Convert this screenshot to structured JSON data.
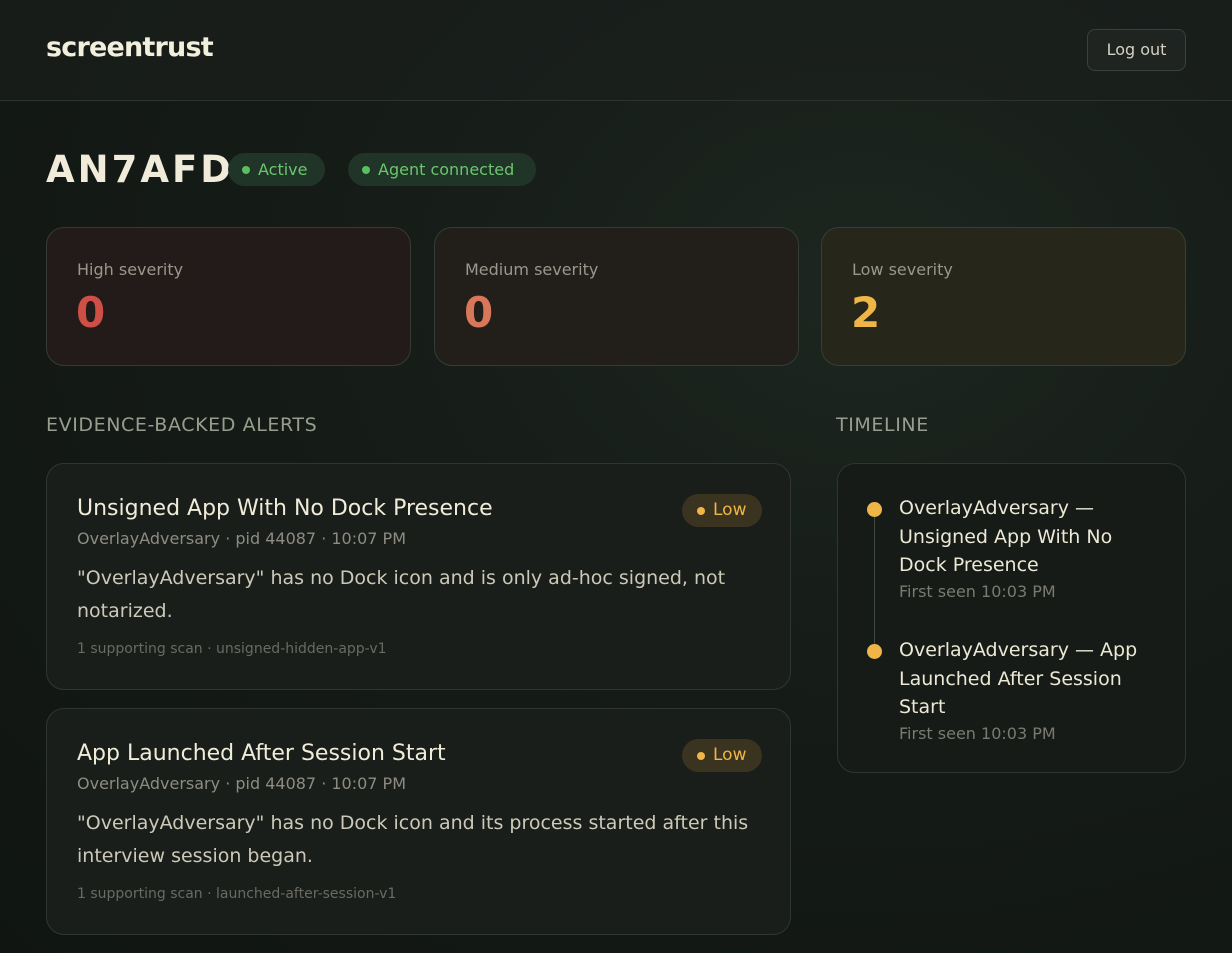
{
  "header": {
    "brand": "screentrust",
    "logout_label": "Log out"
  },
  "session": {
    "id": "AN7AFD",
    "status_label": "Active",
    "agent_label": "Agent connected",
    "status_color": "#5cbf5e"
  },
  "severity": {
    "high": {
      "label": "High severity",
      "value": "0",
      "color": "#cf4e45"
    },
    "medium": {
      "label": "Medium severity",
      "value": "0",
      "color": "#d8775a"
    },
    "low": {
      "label": "Low severity",
      "value": "2",
      "color": "#efb547"
    }
  },
  "alerts_section": {
    "title": "EVIDENCE-BACKED ALERTS",
    "items": [
      {
        "title": "Unsigned App With No Dock Presence",
        "severity": "Low",
        "meta": "OverlayAdversary · pid 44087 · 10:07 PM",
        "description": "\"OverlayAdversary\" has no Dock icon and is only ad-hoc signed, not notarized.",
        "footer": "1 supporting scan · unsigned-hidden-app-v1"
      },
      {
        "title": "App Launched After Session Start",
        "severity": "Low",
        "meta": "OverlayAdversary · pid 44087 · 10:07 PM",
        "description": "\"OverlayAdversary\" has no Dock icon and its process started after this interview session began.",
        "footer": "1 supporting scan · launched-after-session-v1"
      }
    ]
  },
  "timeline": {
    "title": "TIMELINE",
    "items": [
      {
        "title": "OverlayAdversary — Unsigned App With No Dock Presence",
        "time": "First seen 10:03 PM"
      },
      {
        "title": "OverlayAdversary — App Launched After Session Start",
        "time": "First seen 10:03 PM"
      }
    ]
  }
}
